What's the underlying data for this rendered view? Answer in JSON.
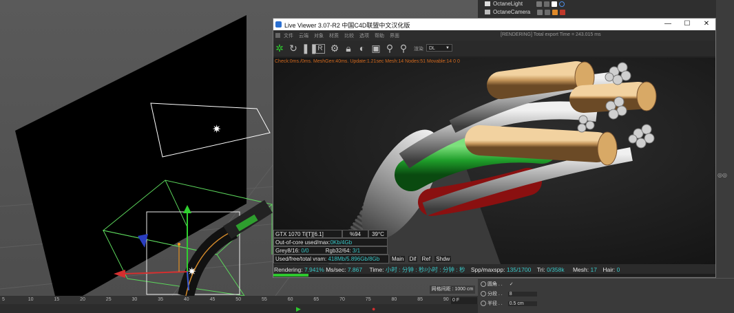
{
  "object_manager": {
    "items": [
      {
        "label": "OctaneLight"
      },
      {
        "label": "OctaneCamera"
      }
    ]
  },
  "live_viewer": {
    "title": "Live Viewer 3.07-R2 中国C4D联盟中文汉化版",
    "window_controls": {
      "minimize": "—",
      "maximize": "☐",
      "close": "✕"
    },
    "menu": [
      "文件",
      "云端",
      "对象",
      "材质",
      "比较",
      "选项",
      "帮助",
      "界面"
    ],
    "render_status": "[RENDERING] Total export Time = 243.015 ms",
    "kernel_prefix": "渲染",
    "kernel_value": "DL",
    "debug_line": "Check:0ms./0ms. MeshGen:40ms. Update:1.21sec Mesh:14 Nodes:51 Movable:14  0 0",
    "info": {
      "gpu": "GTX 1070 Ti[T][6.1]",
      "gpu_util": "%94",
      "gpu_temp": "39°C",
      "outofcore_label": "Out-of-core used/max:",
      "outofcore_value": "0Kb/4Gb",
      "grey_label": "Grey8/16:",
      "grey_value": "0/0",
      "rgb_label": "Rgb32/64:",
      "rgb_value": "3/1",
      "vram_label": "Used/free/total vram:",
      "vram_value": "418Mb/5.896Gb/8Gb"
    },
    "passes": [
      "Main",
      "Dif",
      "Ref",
      "Shdw"
    ],
    "status": {
      "rendering_label": "Rendering:",
      "rendering_value": "7.941%",
      "mspp_label": "Ms/sec:",
      "mspp_value": "7.867",
      "time_label": "Time:",
      "time_value": "小时 : 分钟 : 秒/小时 : 分钟 : 秒",
      "spp_label": "Spp/maxspp:",
      "spp_value": "135/1700",
      "tri_label": "Tri:",
      "tri_value": "0/358k",
      "mesh_label": "Mesh:",
      "mesh_value": "17",
      "hair_label": "Hair:",
      "hair_value": "0"
    },
    "progress": 0.079
  },
  "viewport": {
    "grid_distance": "网格间距 : 1000 cm"
  },
  "timeline": {
    "ticks": [
      "5",
      "10",
      "15",
      "20",
      "25",
      "30",
      "35",
      "40",
      "45",
      "50",
      "55",
      "60",
      "65",
      "70",
      "75",
      "80",
      "85",
      "90"
    ],
    "frame_value": "0 F"
  },
  "attributes": {
    "rows": [
      {
        "label": "圆角 . .",
        "value": "✓"
      },
      {
        "label": "分段 . .",
        "value": "8"
      },
      {
        "label": "半径 . .",
        "value": "0.5 cm"
      }
    ]
  },
  "colors": {
    "accent_cyan": "#39c8c8",
    "progress_green": "#2ec82e",
    "debug_orange": "#d2691e"
  }
}
